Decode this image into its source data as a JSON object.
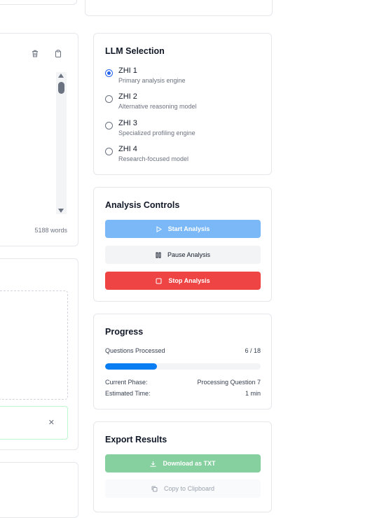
{
  "editor": {
    "word_count": "5188 words"
  },
  "llm": {
    "title": "LLM Selection",
    "options": [
      {
        "name": "ZHI 1",
        "desc": "Primary analysis engine",
        "selected": true
      },
      {
        "name": "ZHI 2",
        "desc": "Alternative reasoning model",
        "selected": false
      },
      {
        "name": "ZHI 3",
        "desc": "Specialized profiling engine",
        "selected": false
      },
      {
        "name": "ZHI 4",
        "desc": "Research-focused model",
        "selected": false
      }
    ]
  },
  "controls": {
    "title": "Analysis Controls",
    "start_label": "Start Analysis",
    "pause_label": "Pause Analysis",
    "stop_label": "Stop Analysis"
  },
  "progress": {
    "title": "Progress",
    "questions_label": "Questions Processed",
    "questions_value": "6 / 18",
    "fraction": 0.3333,
    "phase_label": "Current Phase:",
    "phase_value": "Processing Question 7",
    "time_label": "Estimated Time:",
    "time_value": "1 min"
  },
  "export": {
    "title": "Export Results",
    "download_label": "Download as TXT",
    "copy_label": "Copy to Clipboard"
  },
  "colors": {
    "start_button": "#7ab8f7",
    "stop_button": "#ef4444",
    "progress_fill": "#0a7df2",
    "download_button": "#86cf9f"
  }
}
